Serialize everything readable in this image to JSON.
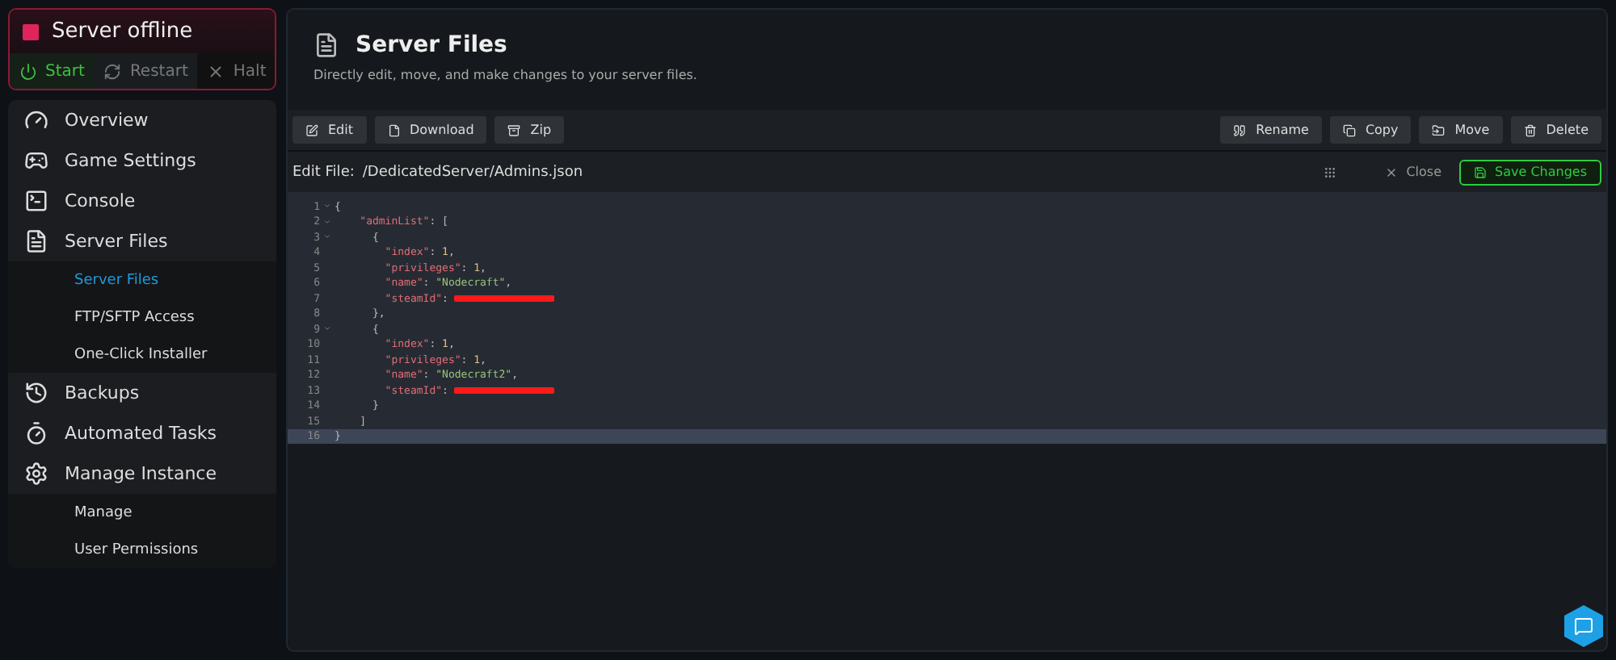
{
  "server": {
    "status": "Server offline",
    "online": false,
    "actions": [
      {
        "kind": "start",
        "label": "Start",
        "disabled": false
      },
      {
        "kind": "restart",
        "label": "Restart",
        "disabled": true
      },
      {
        "kind": "halt",
        "label": "Halt",
        "disabled": true
      }
    ]
  },
  "sidebar": {
    "items": [
      {
        "label": "Overview"
      },
      {
        "label": "Game Settings"
      },
      {
        "label": "Console"
      },
      {
        "label": "Server Files",
        "children": [
          {
            "label": "Server Files",
            "selected": true
          },
          {
            "label": "FTP/SFTP Access",
            "selected": false
          },
          {
            "label": "One-Click Installer",
            "selected": false
          }
        ]
      },
      {
        "label": "Backups"
      },
      {
        "label": "Automated Tasks"
      },
      {
        "label": "Manage Instance",
        "children": [
          {
            "label": "Manage",
            "selected": false
          },
          {
            "label": "User Permissions",
            "selected": false
          }
        ]
      }
    ]
  },
  "page": {
    "title": "Server Files",
    "subtitle": "Directly edit, move, and make changes to your server files."
  },
  "toolbar": {
    "left": [
      {
        "label": "Edit"
      },
      {
        "label": "Download"
      },
      {
        "label": "Zip"
      }
    ],
    "right": [
      {
        "label": "Rename"
      },
      {
        "label": "Copy"
      },
      {
        "label": "Move"
      },
      {
        "label": "Delete"
      }
    ]
  },
  "editor": {
    "label": "Edit File:",
    "path": "/DedicatedServer/Admins.json",
    "close": "Close",
    "save": "Save Changes",
    "lines": [
      {
        "number": "1",
        "foldable": true,
        "active": false,
        "tokens": [
          {
            "kind": "punct",
            "text": "{"
          }
        ]
      },
      {
        "number": "2",
        "foldable": true,
        "active": false,
        "tokens": [
          {
            "kind": "key",
            "text": "    \"adminList\""
          },
          {
            "kind": "punct",
            "text": ": ["
          }
        ]
      },
      {
        "number": "3",
        "foldable": true,
        "active": false,
        "tokens": [
          {
            "kind": "punct",
            "text": "      {"
          }
        ]
      },
      {
        "number": "4",
        "foldable": false,
        "active": false,
        "tokens": [
          {
            "kind": "key",
            "text": "        \"index\""
          },
          {
            "kind": "punct",
            "text": ": "
          },
          {
            "kind": "num",
            "text": "1"
          },
          {
            "kind": "punct",
            "text": ","
          }
        ]
      },
      {
        "number": "5",
        "foldable": false,
        "active": false,
        "tokens": [
          {
            "kind": "key",
            "text": "        \"privileges\""
          },
          {
            "kind": "punct",
            "text": ": "
          },
          {
            "kind": "num",
            "text": "1"
          },
          {
            "kind": "punct",
            "text": ","
          }
        ]
      },
      {
        "number": "6",
        "foldable": false,
        "active": false,
        "tokens": [
          {
            "kind": "key",
            "text": "        \"name\""
          },
          {
            "kind": "punct",
            "text": ": "
          },
          {
            "kind": "str",
            "text": "\"Nodecraft\""
          },
          {
            "kind": "punct",
            "text": ","
          }
        ]
      },
      {
        "number": "7",
        "foldable": false,
        "active": false,
        "tokens": [
          {
            "kind": "key",
            "text": "        \"steamId\""
          },
          {
            "kind": "punct",
            "text": ": "
          },
          {
            "kind": "redacted"
          }
        ]
      },
      {
        "number": "8",
        "foldable": false,
        "active": false,
        "tokens": [
          {
            "kind": "punct",
            "text": "      },"
          }
        ]
      },
      {
        "number": "9",
        "foldable": true,
        "active": false,
        "tokens": [
          {
            "kind": "punct",
            "text": "      {"
          }
        ]
      },
      {
        "number": "10",
        "foldable": false,
        "active": false,
        "tokens": [
          {
            "kind": "key",
            "text": "        \"index\""
          },
          {
            "kind": "punct",
            "text": ": "
          },
          {
            "kind": "num",
            "text": "1"
          },
          {
            "kind": "punct",
            "text": ","
          }
        ]
      },
      {
        "number": "11",
        "foldable": false,
        "active": false,
        "tokens": [
          {
            "kind": "key",
            "text": "        \"privileges\""
          },
          {
            "kind": "punct",
            "text": ": "
          },
          {
            "kind": "num",
            "text": "1"
          },
          {
            "kind": "punct",
            "text": ","
          }
        ]
      },
      {
        "number": "12",
        "foldable": false,
        "active": false,
        "tokens": [
          {
            "kind": "key",
            "text": "        \"name\""
          },
          {
            "kind": "punct",
            "text": ": "
          },
          {
            "kind": "str",
            "text": "\"Nodecraft2\""
          },
          {
            "kind": "punct",
            "text": ","
          }
        ]
      },
      {
        "number": "13",
        "foldable": false,
        "active": false,
        "tokens": [
          {
            "kind": "key",
            "text": "        \"steamId\""
          },
          {
            "kind": "punct",
            "text": ": "
          },
          {
            "kind": "redacted"
          }
        ]
      },
      {
        "number": "14",
        "foldable": false,
        "active": false,
        "tokens": [
          {
            "kind": "punct",
            "text": "      }"
          }
        ]
      },
      {
        "number": "15",
        "foldable": false,
        "active": false,
        "tokens": [
          {
            "kind": "punct",
            "text": "    ]"
          }
        ]
      },
      {
        "number": "16",
        "foldable": false,
        "active": true,
        "tokens": [
          {
            "kind": "punct",
            "text": "}"
          }
        ]
      }
    ]
  }
}
